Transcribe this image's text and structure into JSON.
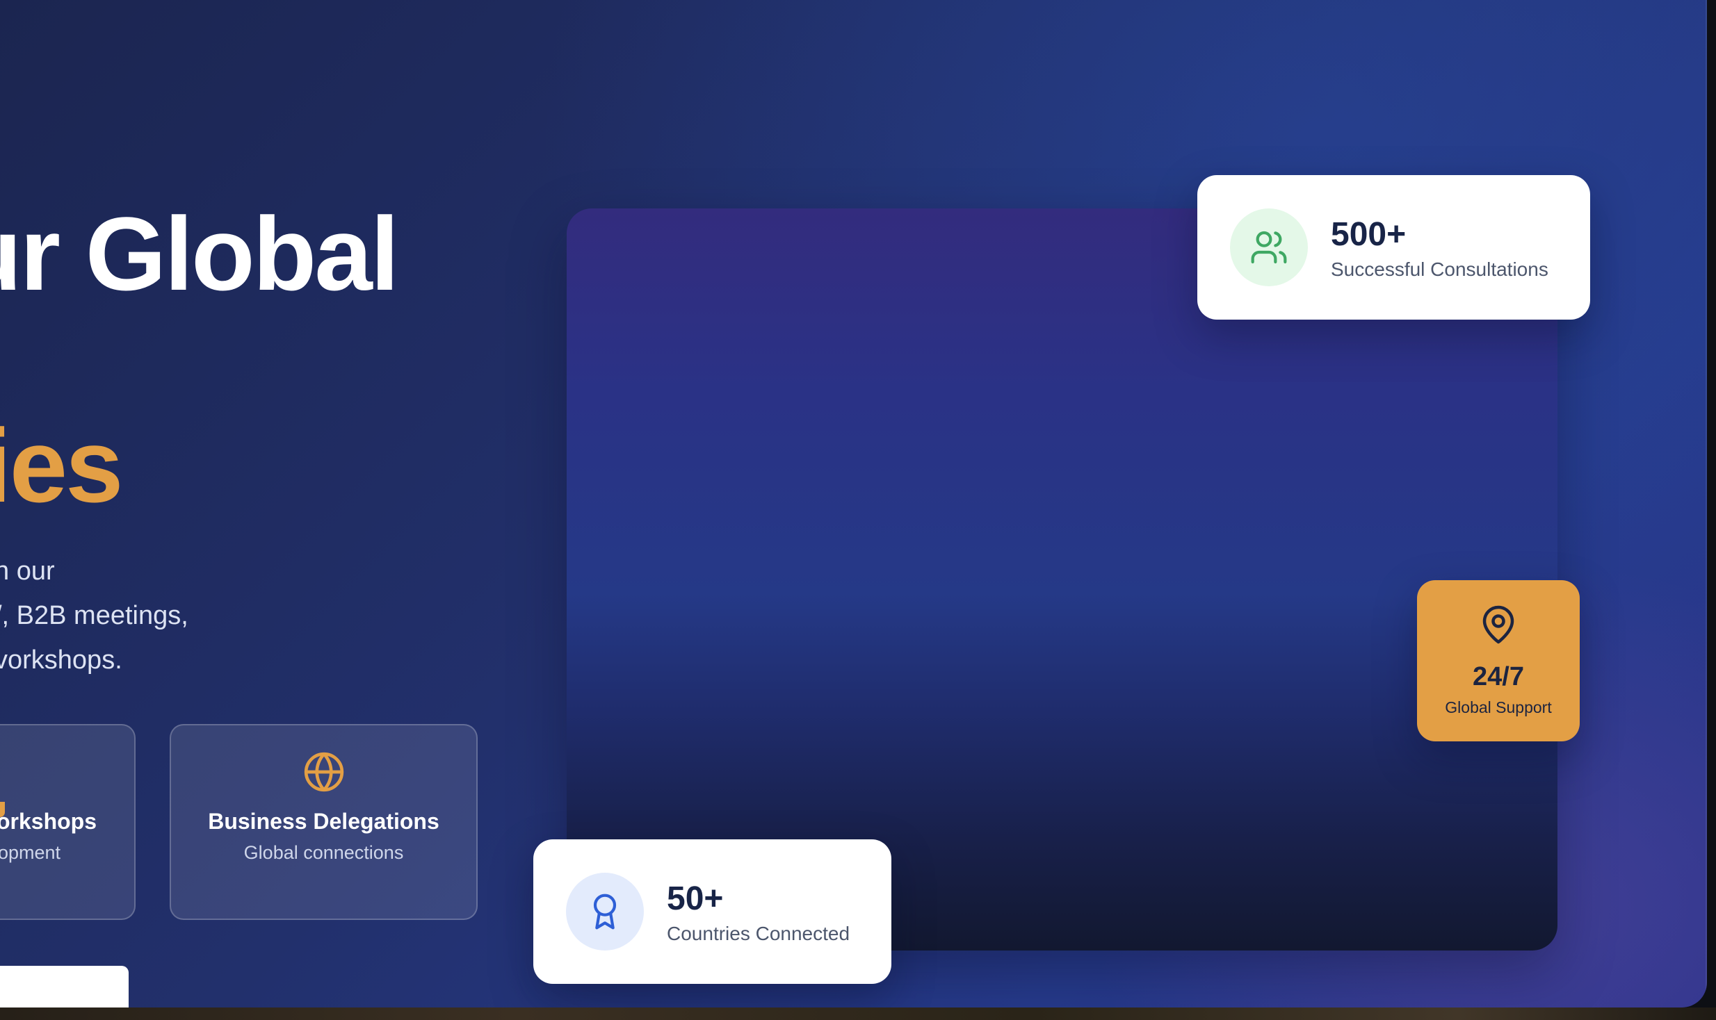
{
  "hero": {
    "title_line1": "ur Global",
    "title_line2": "ies",
    "description_lines": [
      "h our",
      "/, B2B meetings,",
      "vorkshops."
    ]
  },
  "features": [
    {
      "title": "orkshops",
      "subtitle": "opment",
      "icon": "partial-icon",
      "icon_color": "#e39f45"
    },
    {
      "title": "Business Delegations",
      "subtitle": "Global connections",
      "icon": "globe-icon",
      "icon_color": "#e39f45"
    }
  ],
  "stats": {
    "consultations": {
      "value": "500+",
      "label": "Successful Consultations",
      "icon": "users-icon",
      "icon_bg": "#e4f8e8",
      "icon_color": "#3fa863"
    },
    "countries": {
      "value": "50+",
      "label": "Countries Connected",
      "icon": "award-icon",
      "icon_bg": "#e3ebfc",
      "icon_color": "#2e5fd6"
    },
    "support": {
      "value": "24/7",
      "label": "Global Support",
      "icon": "map-pin-icon",
      "bg": "#e39f45"
    }
  },
  "colors": {
    "accent_orange": "#e39f45",
    "text_dark": "#182447",
    "background_navy": "#22306c"
  }
}
